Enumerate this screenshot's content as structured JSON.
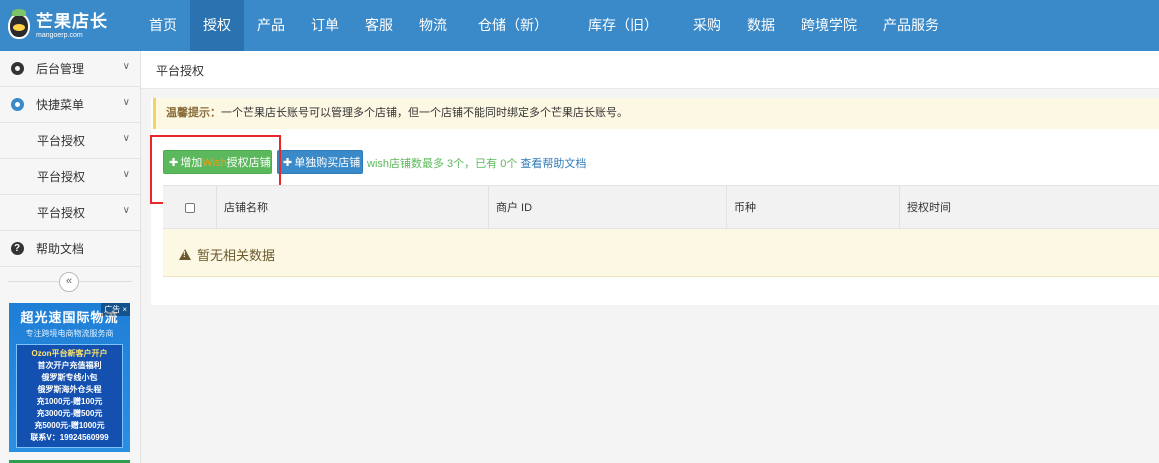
{
  "logo": {
    "name_cn": "芒果店长",
    "domain": "mangoerp.com"
  },
  "nav": {
    "items": [
      {
        "label": "首页"
      },
      {
        "label": "授权"
      },
      {
        "label": "产品"
      },
      {
        "label": "订单"
      },
      {
        "label": "客服"
      },
      {
        "label": "物流"
      },
      {
        "label": "仓储（新）"
      },
      {
        "label": "库存（旧）"
      },
      {
        "label": "采购"
      },
      {
        "label": "数据"
      },
      {
        "label": "跨境学院"
      },
      {
        "label": "产品服务"
      }
    ],
    "active": "授权"
  },
  "sidebar": {
    "items": [
      {
        "label": "后台管理",
        "icon": "gear-icon"
      },
      {
        "label": "快捷菜单",
        "icon": "menu-dot-icon"
      },
      {
        "label": "平台授权"
      },
      {
        "label": "平台授权"
      },
      {
        "label": "平台授权"
      },
      {
        "label": "帮助文档",
        "icon": "help-icon"
      }
    ],
    "collapse_glyph": "«"
  },
  "ad": {
    "tag": "广告",
    "close": "×",
    "title": "超光速国际物流",
    "subtitle": "专注跨境电商物流服务商",
    "lines": [
      "Ozon平台新客户开户",
      "首次开户充值福利",
      "俄罗斯专线小包",
      "俄罗斯海外仓头程",
      "充1000元-赠100元",
      "充3000元-赠500元",
      "充5000元-赠1000元",
      "联系V：19924560999"
    ]
  },
  "breadcrumb": "平台授权",
  "notice": {
    "label": "温馨提示：",
    "text": "一个芒果店长账号可以管理多个店铺，但一个店铺不能同时绑定多个芒果店长账号。"
  },
  "toolbar": {
    "add_prefix": "增加",
    "add_platform": "Wish",
    "add_suffix": "授权店铺",
    "buy_label": "单独购买店铺",
    "info_prefix": "wish店铺数最多 3个，已有 0个",
    "help_link": "查看帮助文档"
  },
  "table": {
    "columns": [
      "店铺名称",
      "商户 ID",
      "币种",
      "授权时间"
    ],
    "empty_text": "暂无相关数据"
  },
  "colors": {
    "nav_bg": "#3a89c9",
    "nav_active": "#2b72b0",
    "btn_green": "#5cb85c",
    "btn_blue": "#3a89c9",
    "highlight_box": "#e8262c",
    "notice_bg": "#fdf8e4"
  }
}
